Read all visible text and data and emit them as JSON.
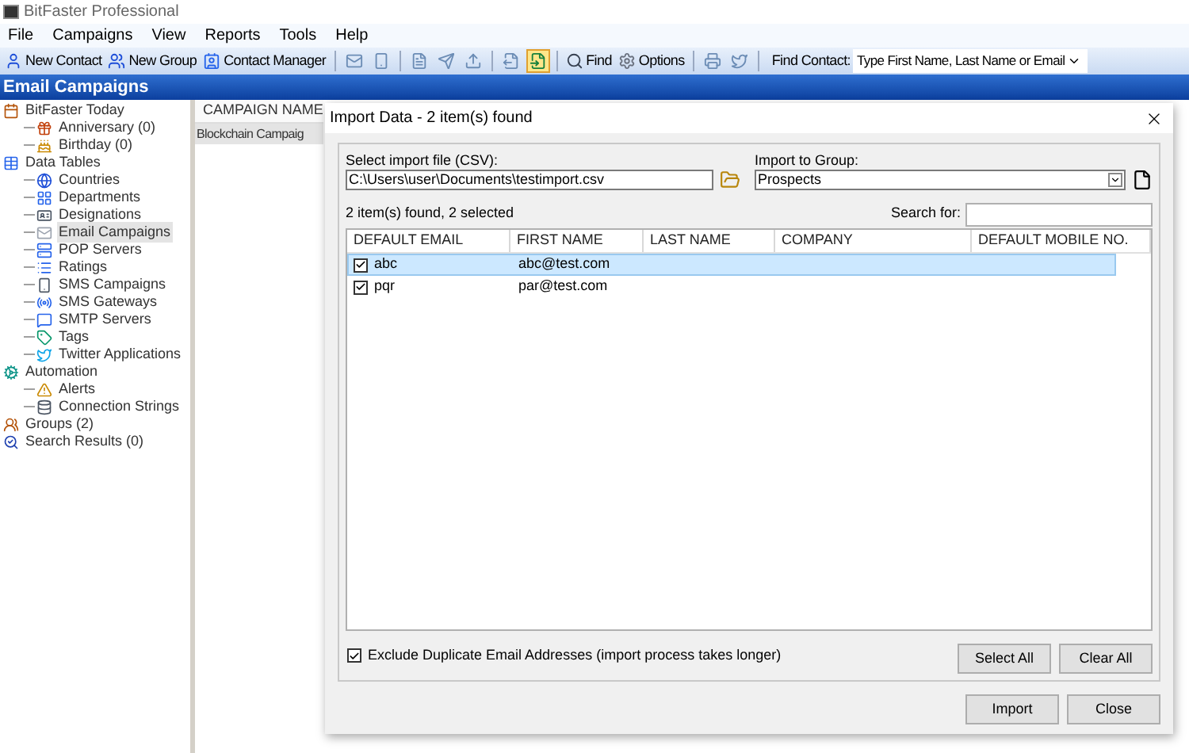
{
  "window": {
    "title": "BitFaster Professional"
  },
  "menu": [
    "File",
    "Campaigns",
    "View",
    "Reports",
    "Tools",
    "Help"
  ],
  "toolbar": [
    {
      "kind": "labeled",
      "label": "New Contact"
    },
    {
      "kind": "labeled",
      "label": "New Group"
    },
    {
      "kind": "labeled",
      "label": "Contact Manager"
    },
    {
      "kind": "separator"
    },
    {
      "kind": "icon",
      "pressed": false
    },
    {
      "kind": "icon",
      "pressed": false
    },
    {
      "kind": "separator"
    },
    {
      "kind": "icon",
      "pressed": false
    },
    {
      "kind": "icon",
      "pressed": false
    },
    {
      "kind": "icon",
      "pressed": false
    },
    {
      "kind": "separator"
    },
    {
      "kind": "icon",
      "pressed": false
    },
    {
      "kind": "icon",
      "pressed": true
    },
    {
      "kind": "separator"
    },
    {
      "kind": "labeled",
      "label": "Find"
    },
    {
      "kind": "labeled",
      "label": "Options"
    },
    {
      "kind": "separator"
    },
    {
      "kind": "icon",
      "pressed": false
    },
    {
      "kind": "icon",
      "pressed": false
    },
    {
      "kind": "separator"
    }
  ],
  "find_contact": {
    "label": "Find Contact:",
    "placeholder": "Type First Name, Last Name or Email"
  },
  "section_title": "Email Campaigns",
  "sidebar": {
    "items": [
      {
        "label": "BitFaster Today",
        "selected": false,
        "children": [
          {
            "label": "Anniversary (0)",
            "selected": false
          },
          {
            "label": "Birthday (0)",
            "selected": false
          }
        ]
      },
      {
        "label": "Data Tables",
        "selected": false,
        "children": [
          {
            "label": "Countries",
            "selected": false
          },
          {
            "label": "Departments",
            "selected": false
          },
          {
            "label": "Designations",
            "selected": false
          },
          {
            "label": "Email Campaigns",
            "selected": true
          },
          {
            "label": "POP Servers",
            "selected": false
          },
          {
            "label": "Ratings",
            "selected": false
          },
          {
            "label": "SMS Campaigns",
            "selected": false
          },
          {
            "label": "SMS Gateways",
            "selected": false
          },
          {
            "label": "SMTP Servers",
            "selected": false
          },
          {
            "label": "Tags",
            "selected": false
          },
          {
            "label": "Twitter Applications",
            "selected": false
          }
        ]
      },
      {
        "label": "Automation",
        "selected": false,
        "children": [
          {
            "label": "Alerts",
            "selected": false
          },
          {
            "label": "Connection Strings",
            "selected": false
          }
        ]
      },
      {
        "label": "Groups (2)",
        "selected": false
      },
      {
        "label": "Search Results (0)",
        "selected": false
      }
    ]
  },
  "campaign_list": {
    "column": "CAMPAIGN NAME",
    "rows": [
      "Blockchain Campaig"
    ]
  },
  "dialog": {
    "title": "Import Data - 2 item(s) found",
    "import_file": {
      "label": "Select import file (CSV):",
      "value": "C:\\Users\\user\\Documents\\testimport.csv"
    },
    "group": {
      "label": "Import to Group:",
      "value": "Prospects"
    },
    "found": "2 item(s) found, 2 selected",
    "search": {
      "label": "Search for:"
    },
    "table": {
      "columns": [
        "DEFAULT EMAIL",
        "FIRST NAME",
        "LAST NAME",
        "COMPANY",
        "DEFAULT MOBILE NO."
      ],
      "rows": [
        {
          "checked": true,
          "selected": true,
          "cells": [
            "abc",
            "abc@test.com"
          ]
        },
        {
          "checked": true,
          "selected": false,
          "cells": [
            "pqr",
            "par@test.com"
          ]
        }
      ]
    },
    "exclude_duplicates": {
      "label": "Exclude Duplicate Email Addresses (import process takes longer)",
      "checked": true
    },
    "buttons": [
      "Select All",
      "Clear All",
      "Import",
      "Close"
    ]
  }
}
